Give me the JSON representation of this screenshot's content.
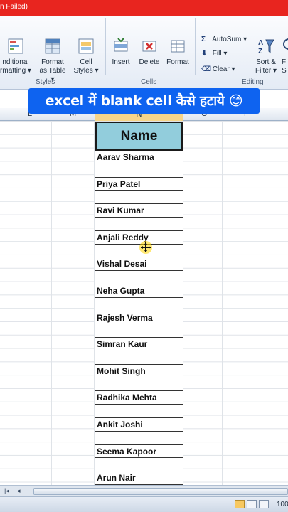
{
  "window": {
    "title_fragment": "n Failed)"
  },
  "ribbon": {
    "styles": {
      "conditional_formatting": [
        "nditional",
        "rmatting ▾"
      ],
      "format_as_table": [
        "Format",
        "as Table ▾"
      ],
      "cell_styles": [
        "Cell",
        "Styles ▾"
      ],
      "label": "Styles"
    },
    "cells": {
      "insert": "Insert",
      "delete": "Delete",
      "format": "Format",
      "label": "Cells"
    },
    "editing": {
      "autosum": "AutoSum ▾",
      "fill": "Fill ▾",
      "clear": "Clear ▾",
      "sort_filter": [
        "Sort &",
        "Filter ▾"
      ],
      "find_select": [
        "F",
        "S"
      ],
      "label": "Editing"
    }
  },
  "caption": "excel में blank cell कैसे हटाये 😊",
  "columns": {
    "L": "L",
    "M": "M",
    "N": "N",
    "O": "O",
    "P": "P"
  },
  "sheet": {
    "header": "Name",
    "names": [
      "Aarav Sharma",
      "Priya Patel",
      "Ravi Kumar",
      "Anjali Reddy",
      "Vishal Desai",
      "Neha Gupta",
      "Rajesh Verma",
      "Simran Kaur",
      "Mohit Singh",
      "Radhika Mehta",
      "Ankit Joshi",
      "Seema Kapoor",
      "Arun Nair"
    ]
  },
  "statusbar": {
    "zoom": "100"
  },
  "colors": {
    "title_bar": "#e8251f",
    "caption_bg": "#0e63f0",
    "header_fill": "#92cddc"
  }
}
